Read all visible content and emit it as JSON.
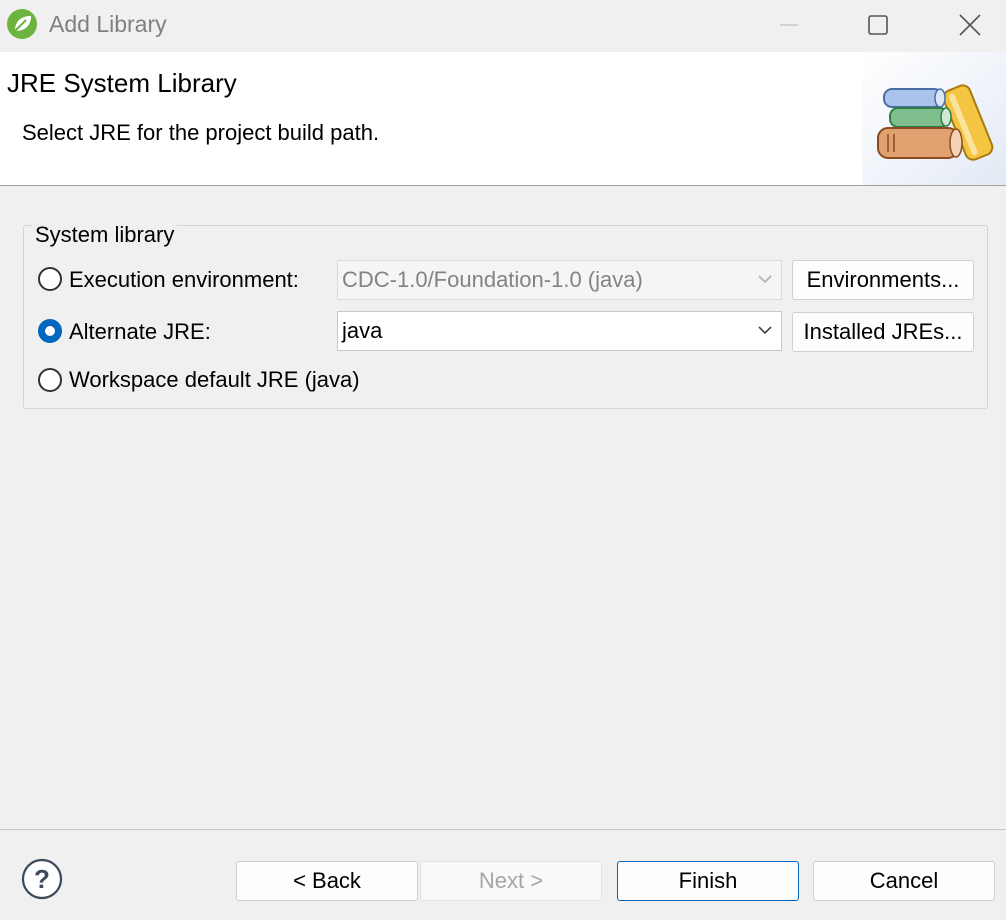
{
  "window": {
    "title": "Add Library",
    "icon": "spring-leaf-icon"
  },
  "banner": {
    "title": "JRE System Library",
    "description": "Select JRE for the project build path.",
    "graphic": "library-books-icon"
  },
  "group": {
    "label": "System library",
    "options": [
      {
        "label": "Execution environment:",
        "selected": false,
        "combo_value": "CDC-1.0/Foundation-1.0 (java)",
        "combo_enabled": false,
        "button": "Environments..."
      },
      {
        "label": "Alternate JRE:",
        "selected": true,
        "combo_value": "java",
        "combo_enabled": true,
        "button": "Installed JREs..."
      },
      {
        "label": "Workspace default JRE (java)",
        "selected": false
      }
    ]
  },
  "footer": {
    "help_icon": "help-icon",
    "back": "< Back",
    "next": "Next >",
    "finish": "Finish",
    "cancel": "Cancel"
  },
  "colors": {
    "accent": "#0067c0",
    "spring_green": "#6db33f"
  }
}
